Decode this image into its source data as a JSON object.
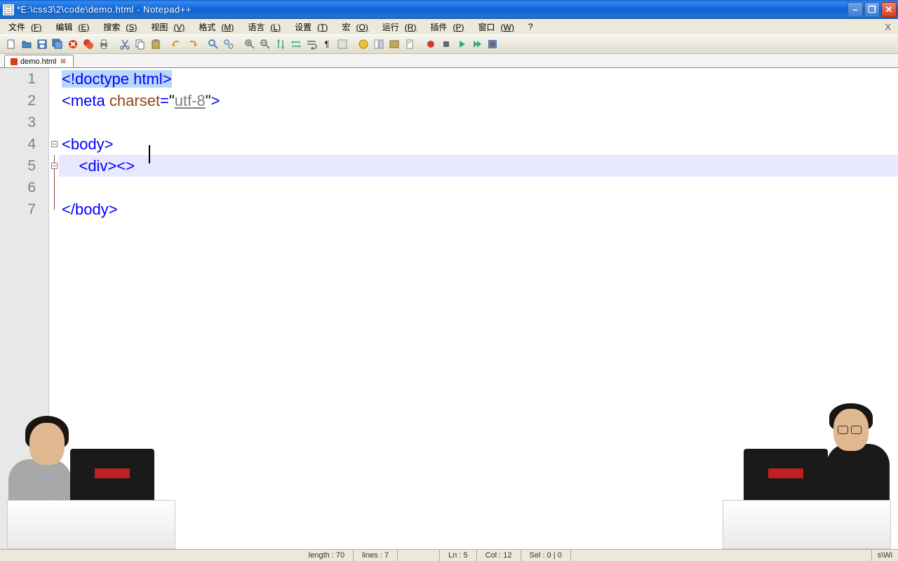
{
  "window": {
    "title": "*E:\\css3\\2\\code\\demo.html - Notepad++"
  },
  "menu": {
    "items": [
      {
        "text": "文件",
        "key": "(F)"
      },
      {
        "text": "编辑",
        "key": "(E)"
      },
      {
        "text": "搜索",
        "key": "(S)"
      },
      {
        "text": "视图",
        "key": "(V)"
      },
      {
        "text": "格式",
        "key": "(M)"
      },
      {
        "text": "语言",
        "key": "(L)"
      },
      {
        "text": "设置",
        "key": "(T)"
      },
      {
        "text": "宏",
        "key": "(O)"
      },
      {
        "text": "运行",
        "key": "(R)"
      },
      {
        "text": "插件",
        "key": "(P)"
      },
      {
        "text": "窗口",
        "key": "(W)"
      },
      {
        "text": "?",
        "key": ""
      }
    ],
    "x": "X"
  },
  "tab": {
    "filename": "demo.html"
  },
  "code": {
    "lines": [
      {
        "num": "1",
        "html": "<span class='sel-hl'><span class='c-punct'>&lt;!</span><span class='c-tag'>doctype html</span><span class='c-punct'>&gt;</span></span>"
      },
      {
        "num": "2",
        "html": "<span class='c-punct'>&lt;</span><span class='c-tag'>meta</span> <span class='c-attr'>charset</span><span class='c-punct'>=</span>\"<span class='c-str'>utf-8</span>\"<span class='c-punct'>&gt;</span>"
      },
      {
        "num": "3",
        "html": ""
      },
      {
        "num": "4",
        "html": "<span class='c-punct'>&lt;</span><span class='c-tag'>body</span><span class='c-punct'>&gt;</span>"
      },
      {
        "num": "5",
        "html": "    <span class='c-punct'>&lt;</span><span class='c-tag'>div</span><span class='c-punct'>&gt;&lt;&gt;</span>",
        "hl": true
      },
      {
        "num": "6",
        "html": ""
      },
      {
        "num": "7",
        "html": "<span class='c-punct'>&lt;/</span><span class='c-tag'>body</span><span class='c-punct'>&gt;</span>"
      }
    ]
  },
  "status": {
    "length": "length : 70",
    "lines": "lines : 7",
    "ln": "Ln : 5",
    "col": "Col : 12",
    "sel": "Sel : 0 | 0",
    "enc": "s\\Wi"
  }
}
